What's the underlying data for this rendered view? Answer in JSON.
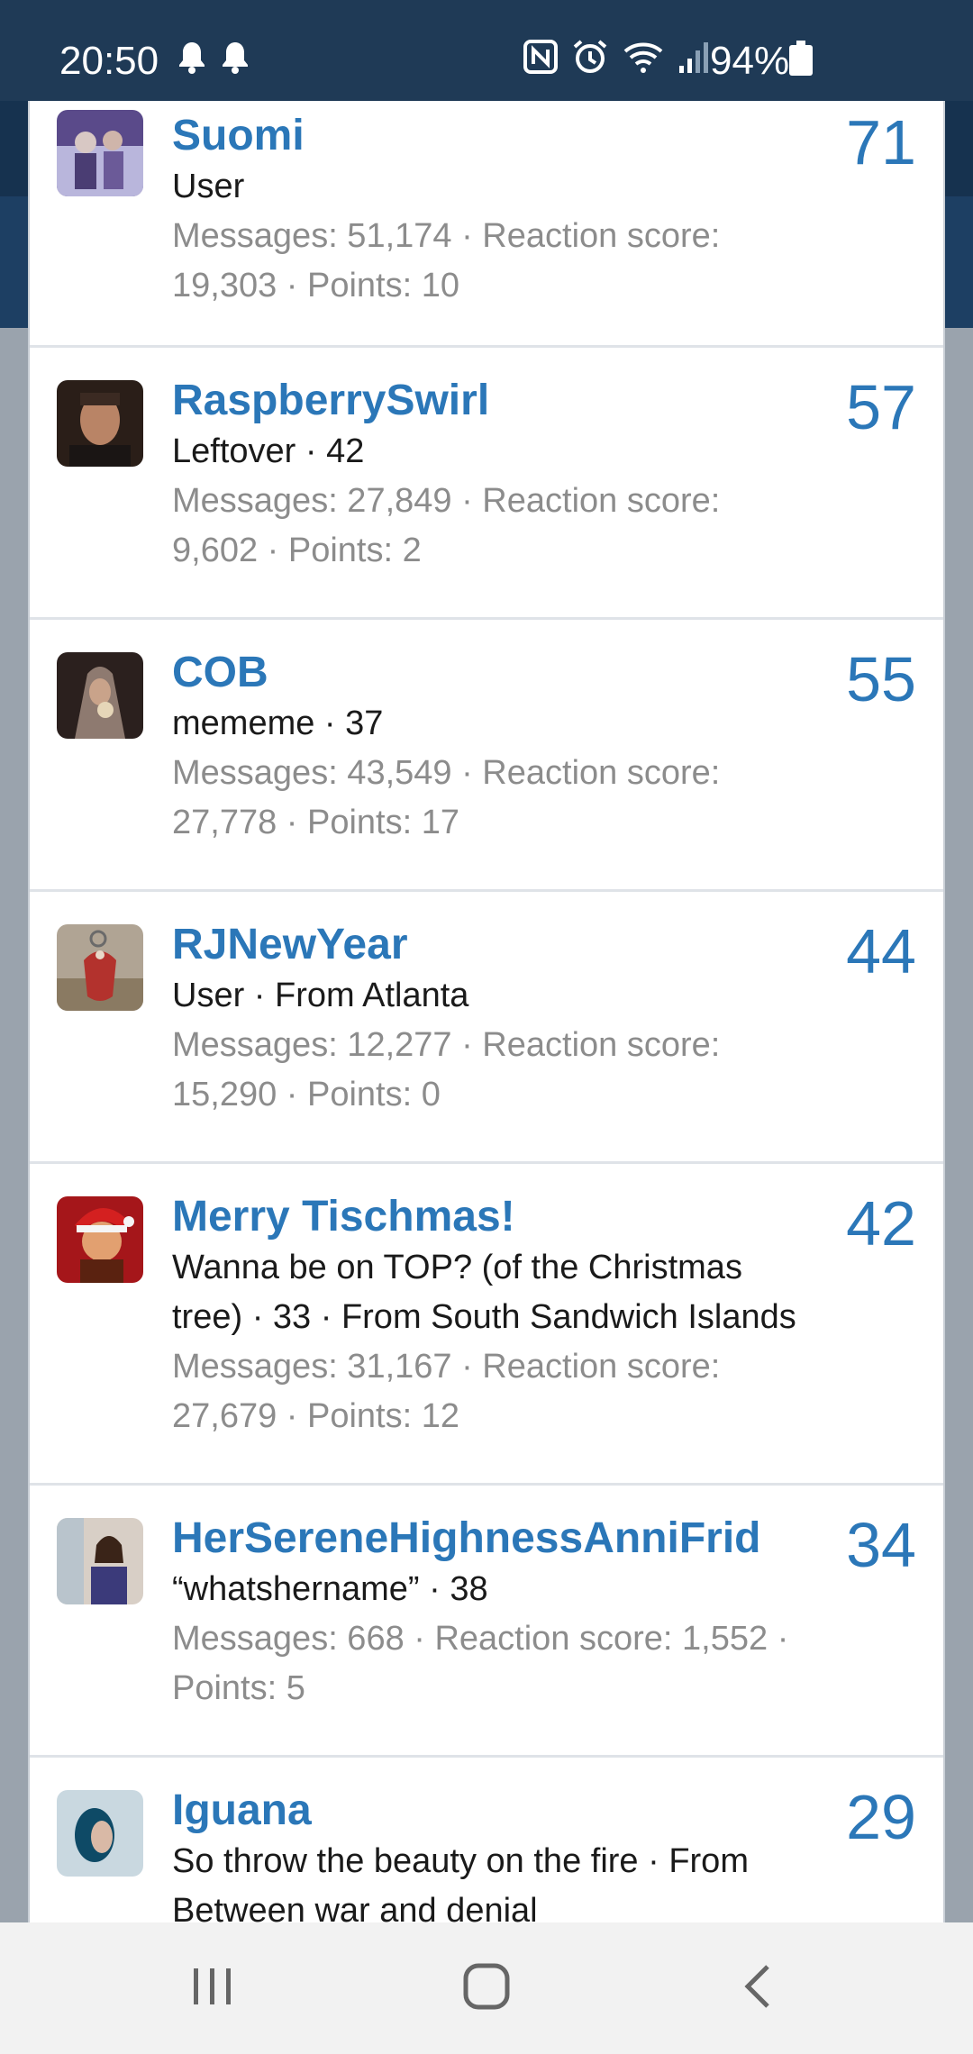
{
  "status_bar": {
    "time": "20:50",
    "battery": "94%",
    "left_icons": [
      "notification-bell-icon",
      "notification-bell-icon"
    ],
    "right_icons": [
      "nfc-icon",
      "alarm-icon",
      "wifi-icon",
      "signal-icon",
      "battery-icon"
    ]
  },
  "members": [
    {
      "name": "Suomi",
      "title": "User",
      "stats": "Messages: 51,174 · Reaction score: 19,303 · Points: 10",
      "count": "71",
      "avatar_colors": [
        "#5a4a8a",
        "#b9b6dc"
      ]
    },
    {
      "name": "RaspberrySwirl",
      "title": "Leftover · 42",
      "stats": "Messages: 27,849 · Reaction score: 9,602 · Points: 2",
      "count": "57",
      "avatar_colors": [
        "#2a1e18",
        "#b98466"
      ]
    },
    {
      "name": "COB",
      "title": "mememe · 37",
      "stats": "Messages: 43,549 · Reaction score: 27,778 · Points: 17",
      "count": "55",
      "avatar_colors": [
        "#2b201e",
        "#8e7a70"
      ]
    },
    {
      "name": "RJNewYear",
      "title": "User · From Atlanta",
      "stats": "Messages: 12,277 · Reaction score: 15,290 · Points: 0",
      "count": "44",
      "avatar_colors": [
        "#b0a494",
        "#b3322d"
      ]
    },
    {
      "name": "Merry Tischmas!",
      "title": "Wanna be on TOP? (of the Christmas tree) · 33 · From South Sandwich Islands",
      "stats": "Messages: 31,167 · Reaction score: 27,679 · Points: 12",
      "count": "42",
      "avatar_colors": [
        "#a5161a",
        "#e2a070"
      ]
    },
    {
      "name": "HerSereneHighnessAnniFrid",
      "title": "“whatshername” · 38",
      "stats": "Messages: 668 · Reaction score: 1,552 · Points: 5",
      "count": "34",
      "avatar_colors": [
        "#d8cfc6",
        "#3b3a7a"
      ]
    },
    {
      "name": "Iguana",
      "title": "So throw the beauty on the fire · From Between war and denial",
      "stats": "",
      "count": "29",
      "avatar_colors": [
        "#0e4a66",
        "#c9d8e0"
      ]
    }
  ],
  "nav_bar": {
    "items": [
      "recent-apps-icon",
      "home-icon",
      "back-icon"
    ]
  },
  "colors": {
    "accent": "#2b77b8",
    "status_bar": "#1f3a56",
    "stats_text": "#8c8c8c"
  }
}
